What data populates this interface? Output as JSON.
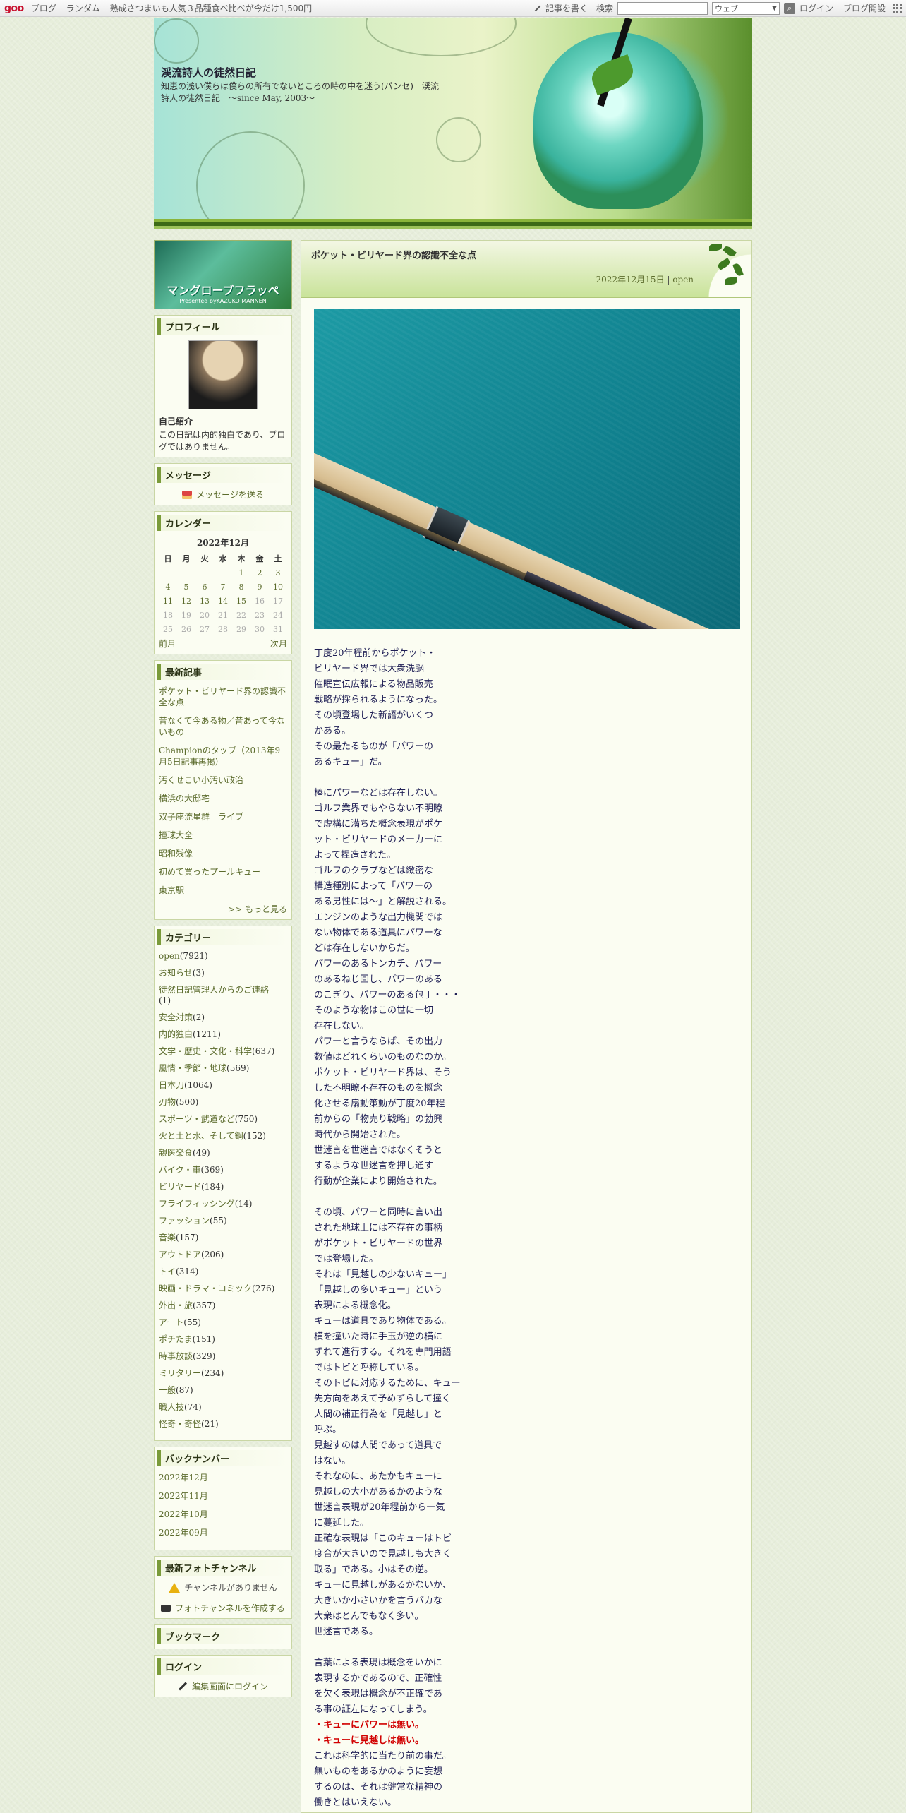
{
  "topbar": {
    "logo": "goo",
    "links": [
      "ブログ",
      "ランダム",
      "熟成さつまいも人気３品種食べ比べが今だけ1,500円"
    ],
    "write": "記事を書く",
    "search_label": "検索",
    "search_placeholder": "",
    "search_scope": "ウェブ",
    "login": "ログイン",
    "open_blog": "ブログ開設"
  },
  "header": {
    "title": "渓流詩人の徒然日記",
    "description": "知恵の浅い僕らは僕らの所有でないところの時の中を迷う(パンセ)　渓流詩人の徒然日記　～since May, 2003～"
  },
  "sidebar": {
    "banner": {
      "title": "マングローブフラッペ",
      "subtitle": "Presented byKAZUKO MANNEN"
    },
    "profile": {
      "heading": "プロフィール",
      "label": "自己紹介",
      "text": "この日記は内的独白であり、ブログではありません。"
    },
    "message": {
      "heading": "メッセージ",
      "link": "メッセージを送る"
    },
    "calendar": {
      "heading": "カレンダー",
      "month": "2022年12月",
      "weekdays": [
        "日",
        "月",
        "火",
        "水",
        "木",
        "金",
        "土"
      ],
      "weeks": [
        [
          "",
          "",
          "",
          "",
          "1",
          "2",
          "3"
        ],
        [
          "4",
          "5",
          "6",
          "7",
          "8",
          "9",
          "10"
        ],
        [
          "11",
          "12",
          "13",
          "14",
          "15",
          "16",
          "17"
        ],
        [
          "18",
          "19",
          "20",
          "21",
          "22",
          "23",
          "24"
        ],
        [
          "25",
          "26",
          "27",
          "28",
          "29",
          "30",
          "31"
        ]
      ],
      "prev": "前月",
      "next": "次月"
    },
    "recent": {
      "heading": "最新記事",
      "items": [
        "ポケット・ビリヤード界の認識不全な点",
        "昔なくて今ある物／昔あって今ないもの",
        "Championのタップ（2013年9月5日記事再掲）",
        "汚くせこい小汚い政治",
        "横浜の大邸宅",
        "双子座流星群　ライブ",
        "撞球大全",
        "昭和残像",
        "初めて買ったプールキュー",
        "東京駅"
      ],
      "more": ">> もっと見る"
    },
    "categories": {
      "heading": "カテゴリー",
      "items": [
        {
          "name": "open",
          "count": "(7921)"
        },
        {
          "name": "お知らせ",
          "count": "(3)"
        },
        {
          "name": "徒然日記管理人からのご連絡",
          "count": "(1)"
        },
        {
          "name": "安全対策",
          "count": "(2)"
        },
        {
          "name": "内的独白",
          "count": "(1211)"
        },
        {
          "name": "文学・歴史・文化・科学",
          "count": "(637)"
        },
        {
          "name": "風情・季節・地球",
          "count": "(569)"
        },
        {
          "name": "日本刀",
          "count": "(1064)"
        },
        {
          "name": "刃物",
          "count": "(500)"
        },
        {
          "name": "スポーツ・武道など",
          "count": "(750)"
        },
        {
          "name": "火と土と水、そして鋼",
          "count": "(152)"
        },
        {
          "name": "親医楽食",
          "count": "(49)"
        },
        {
          "name": "バイク・車",
          "count": "(369)"
        },
        {
          "name": "ビリヤード",
          "count": "(184)"
        },
        {
          "name": "フライフィッシング",
          "count": "(14)"
        },
        {
          "name": "ファッション",
          "count": "(55)"
        },
        {
          "name": "音楽",
          "count": "(157)"
        },
        {
          "name": "アウトドア",
          "count": "(206)"
        },
        {
          "name": "トイ",
          "count": "(314)"
        },
        {
          "name": "映画・ドラマ・コミック",
          "count": "(276)"
        },
        {
          "name": "外出・旅",
          "count": "(357)"
        },
        {
          "name": "アート",
          "count": "(55)"
        },
        {
          "name": "ポチたま",
          "count": "(151)"
        },
        {
          "name": "時事放談",
          "count": "(329)"
        },
        {
          "name": "ミリタリー",
          "count": "(234)"
        },
        {
          "name": "一般",
          "count": "(87)"
        },
        {
          "name": "職人技",
          "count": "(74)"
        },
        {
          "name": "怪奇・奇怪",
          "count": "(21)"
        }
      ]
    },
    "backnumber": {
      "heading": "バックナンバー",
      "items": [
        "2022年12月",
        "2022年11月",
        "2022年10月",
        "2022年09月"
      ]
    },
    "photochannel": {
      "heading": "最新フォトチャンネル",
      "empty": "チャンネルがありません",
      "create": "フォトチャンネルを作成する"
    },
    "bookmark": {
      "heading": "ブックマーク"
    },
    "login": {
      "heading": "ログイン",
      "link": "編集画面にログイン"
    }
  },
  "post": {
    "title": "ポケット・ビリヤード界の認識不全な点",
    "date": "2022年12月15日",
    "separator": " | ",
    "category": "open",
    "paragraphs": [
      "丁度20年程前からポケット・\nビリヤード界では大衆洗脳\n催眠宣伝広報による物品販売\n戦略が採られるようになった。\nその頃登場した新語がいくつ\nかある。\nその最たるものが「パワーの\nあるキュー」だ。",
      "棒にパワーなどは存在しない。\nゴルフ業界でもやらない不明瞭\nで虚構に満ちた概念表現がポケ\nット・ビリヤードのメーカーに\nよって捏造された。\nゴルフのクラブなどは緻密な\n構造種別によって「パワーの\nある男性には～」と解説される。\nエンジンのような出力機関では\nない物体である道具にパワーな\nどは存在しないからだ。\nパワーのあるトンカチ、パワー\nのあるねじ回し、パワーのある\nのこぎり、パワーのある包丁・・・\nそのような物はこの世に一切\n存在しない。\nパワーと言うならば、その出力\n数値はどれくらいのものなのか。\nポケット・ビリヤード界は、そう\nした不明瞭不存在のものを概念\n化させる扇動策動が丁度20年程\n前からの「物売り戦略」の勃興\n時代から開始された。\n世迷言を世迷言ではなくそうと\nするような世迷言を押し通す\n行動が企業により開始された。",
      "その頃、パワーと同時に言い出\nされた地球上には不存在の事柄\nがポケット・ビリヤードの世界\nでは登場した。\nそれは「見越しの少ないキュー」\n「見越しの多いキュー」という\n表現による概念化。\nキューは道具であり物体である。\n横を撞いた時に手玉が逆の横に\nずれて進行する。それを専門用語\nではトビと呼称している。\nそのトビに対応するために、キュー\n先方向をあえて予めずらして撞く\n人間の補正行為を「見越し」と\n呼ぶ。\n見越すのは人間であって道具で\nはない。\nそれなのに、あたかもキューに\n見越しの大小があるかのような\n世迷言表現が20年程前から一気\nに蔓延した。\n正確な表現は「このキューはトビ\n度合が大きいので見越しも大きく\n取る」である。小はその逆。\nキューに見越しがあるかないか、\n大きいか小さいかを言うバカな\n大衆はとんでもなく多い。\n世迷言である。",
      "言葉による表現は概念をいかに\n表現するかであるので、正確性\nを欠く表現は概念が不正確であ\nる事の証左になってしまう。"
    ],
    "emphasis": [
      "・キューにパワーは無い。",
      "・キューに見越しは無い。"
    ],
    "closing": "これは科学的に当たり前の事だ。\n無いものをあるかのように妄想\nするのは、それは健常な精神の\n働きとはいえない。"
  }
}
